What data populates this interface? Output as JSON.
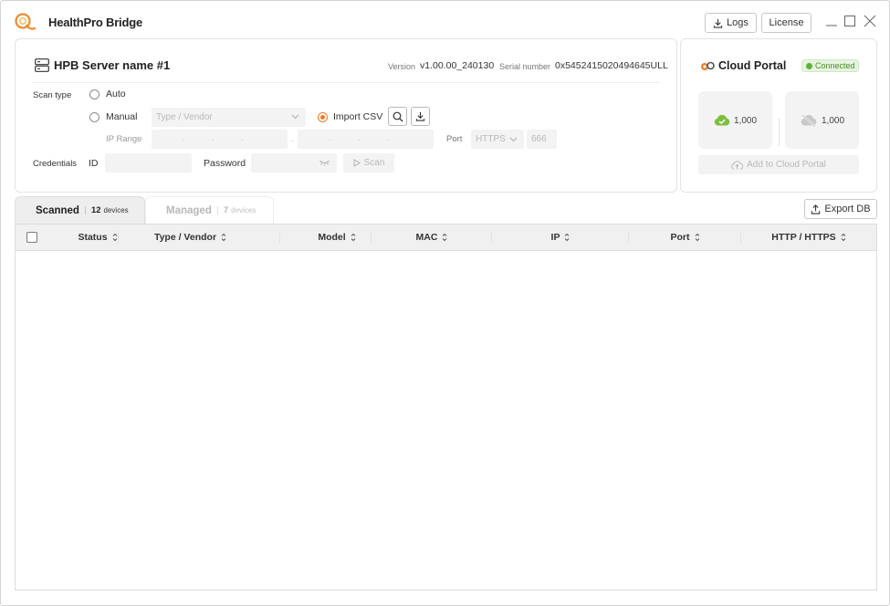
{
  "app": {
    "title": "HealthPro Bridge"
  },
  "titlebar": {
    "logs_label": "Logs",
    "license_label": "License"
  },
  "server": {
    "name": "HPB Server name #1",
    "version_label": "Version",
    "version_value": "v1.00.00_240130",
    "serial_label": "Serial number",
    "serial_value": "0x5452415020494645ULL"
  },
  "scan_form": {
    "scan_type_label": "Scan type",
    "auto_label": "Auto",
    "manual_label": "Manual",
    "selected_type": "import_csv",
    "vendor_placeholder": "Type / Vendor",
    "import_csv_label": "Import CSV",
    "ip_range_label": "IP Range",
    "port_label": "Port",
    "protocol_value": "HTTPS",
    "port_value": "666",
    "credentials_label": "Credentials",
    "id_label": "ID",
    "password_label": "Password",
    "scan_button_label": "Scan"
  },
  "cloud": {
    "title": "Cloud Portal",
    "status": "Connected",
    "online_count": "1,000",
    "offline_count": "1,000",
    "add_button_label": "Add to Cloud Portal"
  },
  "tabs": [
    {
      "label": "Scanned",
      "count": "12",
      "unit": "devices",
      "active": true
    },
    {
      "label": "Managed",
      "count": "7",
      "unit": "devices",
      "active": false
    }
  ],
  "export_label": "Export DB",
  "table": {
    "columns": [
      "Status",
      "Type / Vendor",
      "Model",
      "MAC",
      "IP",
      "Port",
      "HTTP / HTTPS"
    ],
    "rows": []
  },
  "colors": {
    "accent": "#ec7a24",
    "connected": "#5fb13b"
  }
}
